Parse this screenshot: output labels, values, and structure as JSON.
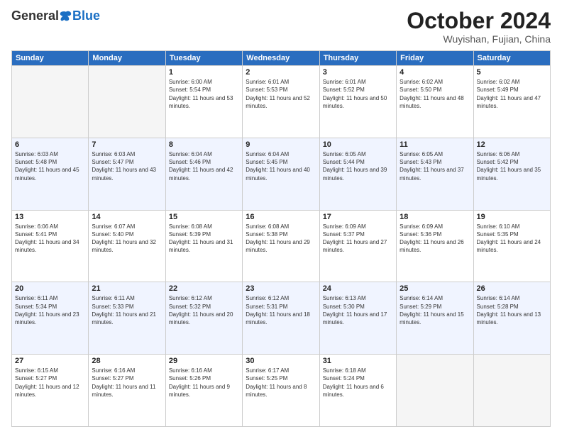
{
  "header": {
    "logo_general": "General",
    "logo_blue": "Blue",
    "month": "October 2024",
    "location": "Wuyishan, Fujian, China"
  },
  "weekdays": [
    "Sunday",
    "Monday",
    "Tuesday",
    "Wednesday",
    "Thursday",
    "Friday",
    "Saturday"
  ],
  "weeks": [
    [
      {
        "day": "",
        "sunrise": "",
        "sunset": "",
        "daylight": ""
      },
      {
        "day": "",
        "sunrise": "",
        "sunset": "",
        "daylight": ""
      },
      {
        "day": "1",
        "sunrise": "Sunrise: 6:00 AM",
        "sunset": "Sunset: 5:54 PM",
        "daylight": "Daylight: 11 hours and 53 minutes."
      },
      {
        "day": "2",
        "sunrise": "Sunrise: 6:01 AM",
        "sunset": "Sunset: 5:53 PM",
        "daylight": "Daylight: 11 hours and 52 minutes."
      },
      {
        "day": "3",
        "sunrise": "Sunrise: 6:01 AM",
        "sunset": "Sunset: 5:52 PM",
        "daylight": "Daylight: 11 hours and 50 minutes."
      },
      {
        "day": "4",
        "sunrise": "Sunrise: 6:02 AM",
        "sunset": "Sunset: 5:50 PM",
        "daylight": "Daylight: 11 hours and 48 minutes."
      },
      {
        "day": "5",
        "sunrise": "Sunrise: 6:02 AM",
        "sunset": "Sunset: 5:49 PM",
        "daylight": "Daylight: 11 hours and 47 minutes."
      }
    ],
    [
      {
        "day": "6",
        "sunrise": "Sunrise: 6:03 AM",
        "sunset": "Sunset: 5:48 PM",
        "daylight": "Daylight: 11 hours and 45 minutes."
      },
      {
        "day": "7",
        "sunrise": "Sunrise: 6:03 AM",
        "sunset": "Sunset: 5:47 PM",
        "daylight": "Daylight: 11 hours and 43 minutes."
      },
      {
        "day": "8",
        "sunrise": "Sunrise: 6:04 AM",
        "sunset": "Sunset: 5:46 PM",
        "daylight": "Daylight: 11 hours and 42 minutes."
      },
      {
        "day": "9",
        "sunrise": "Sunrise: 6:04 AM",
        "sunset": "Sunset: 5:45 PM",
        "daylight": "Daylight: 11 hours and 40 minutes."
      },
      {
        "day": "10",
        "sunrise": "Sunrise: 6:05 AM",
        "sunset": "Sunset: 5:44 PM",
        "daylight": "Daylight: 11 hours and 39 minutes."
      },
      {
        "day": "11",
        "sunrise": "Sunrise: 6:05 AM",
        "sunset": "Sunset: 5:43 PM",
        "daylight": "Daylight: 11 hours and 37 minutes."
      },
      {
        "day": "12",
        "sunrise": "Sunrise: 6:06 AM",
        "sunset": "Sunset: 5:42 PM",
        "daylight": "Daylight: 11 hours and 35 minutes."
      }
    ],
    [
      {
        "day": "13",
        "sunrise": "Sunrise: 6:06 AM",
        "sunset": "Sunset: 5:41 PM",
        "daylight": "Daylight: 11 hours and 34 minutes."
      },
      {
        "day": "14",
        "sunrise": "Sunrise: 6:07 AM",
        "sunset": "Sunset: 5:40 PM",
        "daylight": "Daylight: 11 hours and 32 minutes."
      },
      {
        "day": "15",
        "sunrise": "Sunrise: 6:08 AM",
        "sunset": "Sunset: 5:39 PM",
        "daylight": "Daylight: 11 hours and 31 minutes."
      },
      {
        "day": "16",
        "sunrise": "Sunrise: 6:08 AM",
        "sunset": "Sunset: 5:38 PM",
        "daylight": "Daylight: 11 hours and 29 minutes."
      },
      {
        "day": "17",
        "sunrise": "Sunrise: 6:09 AM",
        "sunset": "Sunset: 5:37 PM",
        "daylight": "Daylight: 11 hours and 27 minutes."
      },
      {
        "day": "18",
        "sunrise": "Sunrise: 6:09 AM",
        "sunset": "Sunset: 5:36 PM",
        "daylight": "Daylight: 11 hours and 26 minutes."
      },
      {
        "day": "19",
        "sunrise": "Sunrise: 6:10 AM",
        "sunset": "Sunset: 5:35 PM",
        "daylight": "Daylight: 11 hours and 24 minutes."
      }
    ],
    [
      {
        "day": "20",
        "sunrise": "Sunrise: 6:11 AM",
        "sunset": "Sunset: 5:34 PM",
        "daylight": "Daylight: 11 hours and 23 minutes."
      },
      {
        "day": "21",
        "sunrise": "Sunrise: 6:11 AM",
        "sunset": "Sunset: 5:33 PM",
        "daylight": "Daylight: 11 hours and 21 minutes."
      },
      {
        "day": "22",
        "sunrise": "Sunrise: 6:12 AM",
        "sunset": "Sunset: 5:32 PM",
        "daylight": "Daylight: 11 hours and 20 minutes."
      },
      {
        "day": "23",
        "sunrise": "Sunrise: 6:12 AM",
        "sunset": "Sunset: 5:31 PM",
        "daylight": "Daylight: 11 hours and 18 minutes."
      },
      {
        "day": "24",
        "sunrise": "Sunrise: 6:13 AM",
        "sunset": "Sunset: 5:30 PM",
        "daylight": "Daylight: 11 hours and 17 minutes."
      },
      {
        "day": "25",
        "sunrise": "Sunrise: 6:14 AM",
        "sunset": "Sunset: 5:29 PM",
        "daylight": "Daylight: 11 hours and 15 minutes."
      },
      {
        "day": "26",
        "sunrise": "Sunrise: 6:14 AM",
        "sunset": "Sunset: 5:28 PM",
        "daylight": "Daylight: 11 hours and 13 minutes."
      }
    ],
    [
      {
        "day": "27",
        "sunrise": "Sunrise: 6:15 AM",
        "sunset": "Sunset: 5:27 PM",
        "daylight": "Daylight: 11 hours and 12 minutes."
      },
      {
        "day": "28",
        "sunrise": "Sunrise: 6:16 AM",
        "sunset": "Sunset: 5:27 PM",
        "daylight": "Daylight: 11 hours and 11 minutes."
      },
      {
        "day": "29",
        "sunrise": "Sunrise: 6:16 AM",
        "sunset": "Sunset: 5:26 PM",
        "daylight": "Daylight: 11 hours and 9 minutes."
      },
      {
        "day": "30",
        "sunrise": "Sunrise: 6:17 AM",
        "sunset": "Sunset: 5:25 PM",
        "daylight": "Daylight: 11 hours and 8 minutes."
      },
      {
        "day": "31",
        "sunrise": "Sunrise: 6:18 AM",
        "sunset": "Sunset: 5:24 PM",
        "daylight": "Daylight: 11 hours and 6 minutes."
      },
      {
        "day": "",
        "sunrise": "",
        "sunset": "",
        "daylight": ""
      },
      {
        "day": "",
        "sunrise": "",
        "sunset": "",
        "daylight": ""
      }
    ]
  ]
}
